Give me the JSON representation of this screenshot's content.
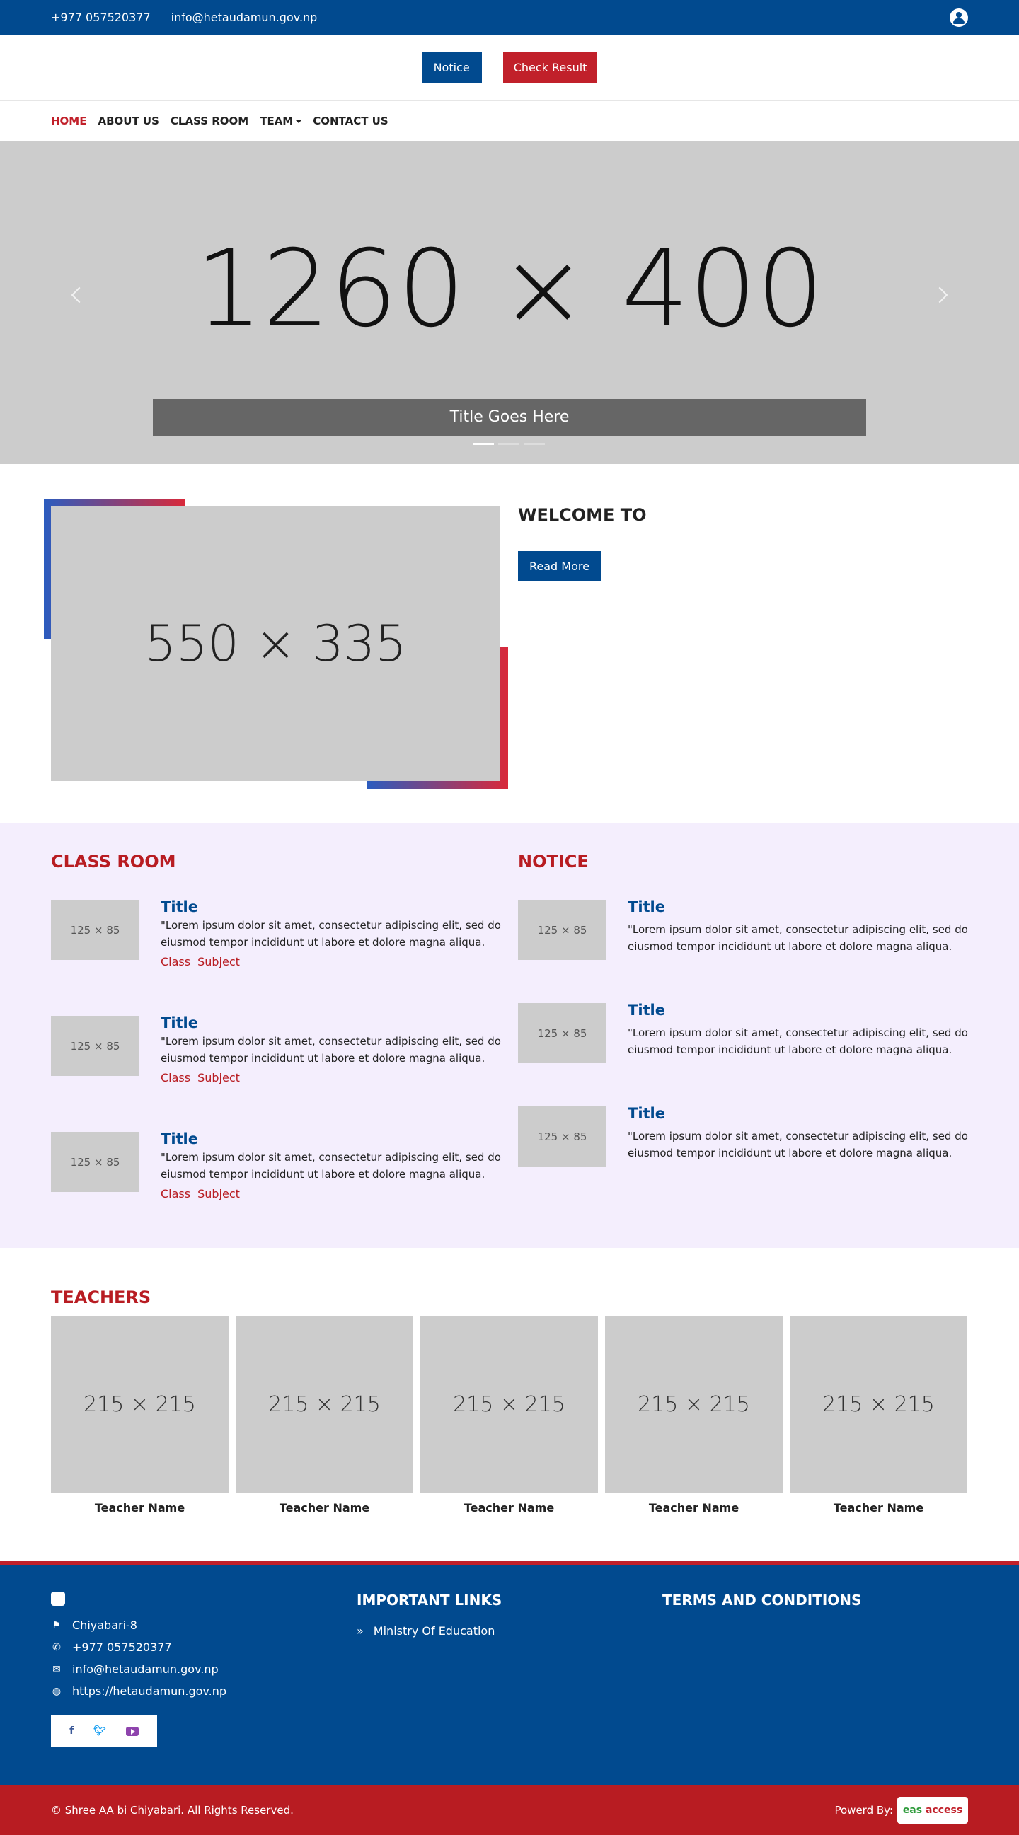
{
  "topbar": {
    "phone": "+977 057520377",
    "email": "info@hetaudamun.gov.np"
  },
  "header": {
    "notice_button": "Notice",
    "result_button": "Check Result"
  },
  "nav": {
    "items": [
      "HOME",
      "ABOUT US",
      "CLASS ROOM",
      "TEAM",
      "CONTACT US"
    ]
  },
  "slider": {
    "placeholder": "1260 × 400",
    "caption": "Title Goes Here"
  },
  "welcome": {
    "placeholder": "550 × 335",
    "title": "WELCOME TO",
    "button": "Read More"
  },
  "classroom": {
    "heading": "CLASS ROOM",
    "items": [
      {
        "thumb": "125 × 85",
        "title": "Title",
        "text": "\"Lorem ipsum dolor sit amet, consectetur adipiscing elit, sed do eiusmod tempor incididunt ut labore et dolore magna aliqua.",
        "class": "Class",
        "subject": "Subject"
      },
      {
        "thumb": "125 × 85",
        "title": "Title",
        "text": "\"Lorem ipsum dolor sit amet, consectetur adipiscing elit, sed do eiusmod tempor incididunt ut labore et dolore magna aliqua.",
        "class": "Class",
        "subject": "Subject"
      },
      {
        "thumb": "125 × 85",
        "title": "Title",
        "text": "\"Lorem ipsum dolor sit amet, consectetur adipiscing elit, sed do eiusmod tempor incididunt ut labore et dolore magna aliqua.",
        "class": "Class",
        "subject": "Subject"
      }
    ]
  },
  "notice": {
    "heading": "NOTICE",
    "items": [
      {
        "thumb": "125 × 85",
        "title": "Title",
        "text": "\"Lorem ipsum dolor sit amet, consectetur adipiscing elit, sed do eiusmod tempor incididunt ut labore et dolore magna aliqua."
      },
      {
        "thumb": "125 × 85",
        "title": "Title",
        "text": "\"Lorem ipsum dolor sit amet, consectetur adipiscing elit, sed do eiusmod tempor incididunt ut labore et dolore magna aliqua."
      },
      {
        "thumb": "125 × 85",
        "title": "Title",
        "text": "\"Lorem ipsum dolor sit amet, consectetur adipiscing elit, sed do eiusmod tempor incididunt ut labore et dolore magna aliqua."
      }
    ]
  },
  "teachers": {
    "heading": "TEACHERS",
    "items": [
      {
        "placeholder": "215 × 215",
        "name": "Teacher Name"
      },
      {
        "placeholder": "215 × 215",
        "name": "Teacher Name"
      },
      {
        "placeholder": "215 × 215",
        "name": "Teacher Name"
      },
      {
        "placeholder": "215 × 215",
        "name": "Teacher Name"
      },
      {
        "placeholder": "215 × 215",
        "name": "Teacher Name"
      }
    ]
  },
  "footer": {
    "address": "Chiyabari-8",
    "phone": "+977 057520377",
    "email": "info@hetaudamun.gov.np",
    "website": "https://hetaudamun.gov.np",
    "links_heading": "IMPORTANT LINKS",
    "link": "Ministry Of Education",
    "terms_heading": "TERMS AND CONDITIONS",
    "social": {
      "facebook": "f"
    }
  },
  "copyright": {
    "text": "© Shree AA bi Chiyabari. All Rights Reserved.",
    "powered": "Powerd By:",
    "brand_left": "eas",
    "brand_right": "access"
  },
  "colors": {
    "primary": "#014a8f",
    "accent": "#c1202a",
    "light_bg": "#f4eefd",
    "placeholder": "#cccccc"
  }
}
